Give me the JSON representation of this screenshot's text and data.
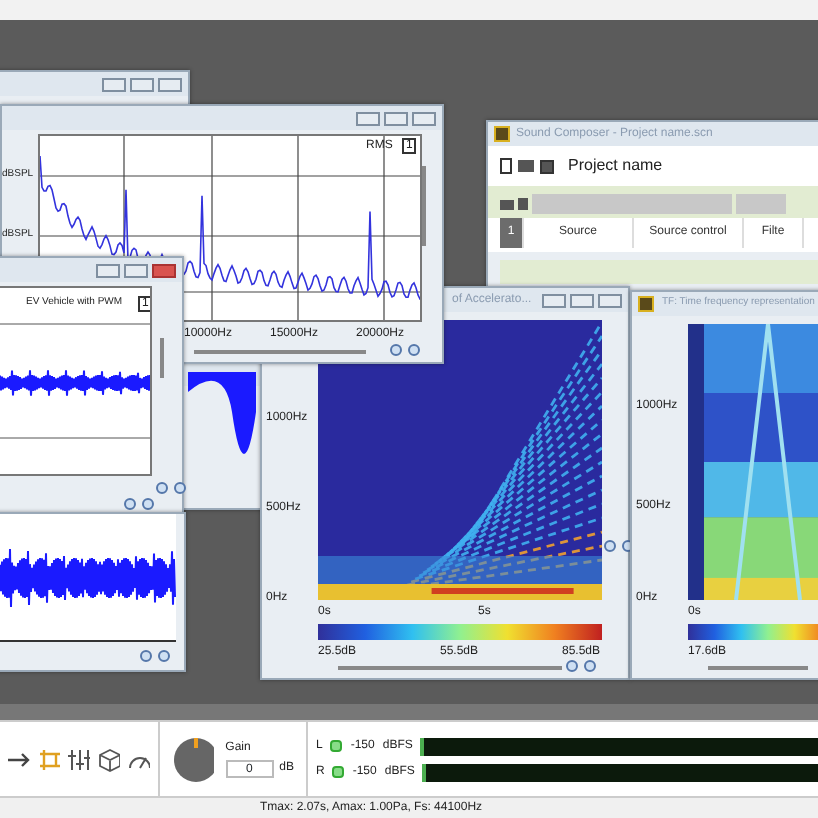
{
  "spectrum_window": {
    "y_labels": [
      "dBSPL",
      "dBSPL"
    ],
    "legend": "RMS",
    "legend_index": "1",
    "x_ticks": [
      "10000Hz",
      "15000Hz",
      "20000Hz"
    ]
  },
  "waveform_window": {
    "legend": "EV Vehicle with PWM",
    "legend_index": "1"
  },
  "project_window": {
    "title": "Sound Composer - Project name.scn",
    "project_name": "Project name",
    "columns": [
      "1",
      "Source",
      "Source control",
      "Filte"
    ]
  },
  "spectrogram_windows": [
    {
      "title": "of Accelerato...",
      "y_ticks": [
        "1000Hz",
        "500Hz",
        "0Hz"
      ],
      "x_ticks": [
        "0s",
        "5s"
      ],
      "colorbar_labels": [
        "25.5dB",
        "55.5dB",
        "85.5dB"
      ]
    },
    {
      "title": "TF: Time frequency representation",
      "y_ticks": [
        "1000Hz",
        "500Hz",
        "0Hz"
      ],
      "x_ticks": [
        "0s"
      ],
      "colorbar_labels": [
        "17.6dB"
      ]
    }
  ],
  "toolbar": {
    "gain_label": "Gain",
    "gain_value": "0",
    "gain_unit": "dB",
    "meters": [
      {
        "channel": "L",
        "value": "-150",
        "unit": "dBFS",
        "level": 0.01
      },
      {
        "channel": "R",
        "value": "-150",
        "unit": "dBFS",
        "level": 0.01
      }
    ]
  },
  "status_bar": "Tmax: 2.07s, Amax: 1.00Pa, Fs: 44100Hz"
}
